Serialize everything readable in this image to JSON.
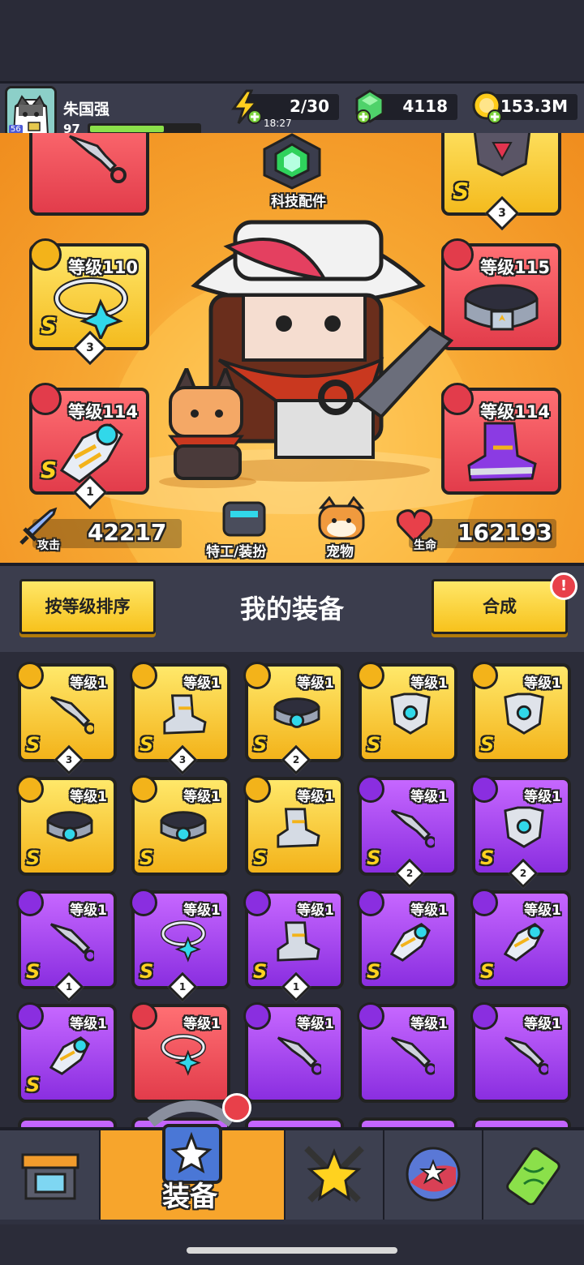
{
  "player": {
    "name": "朱国强",
    "level": "97",
    "avatar_badge": "56",
    "xp_fraction": 0.68
  },
  "resources": {
    "energy": "2/30",
    "energy_timer": "18:27",
    "gems": "4118",
    "coins": "153.3M"
  },
  "stage": {
    "tech_label": "科技配件",
    "slots": [
      {
        "id": "weapon",
        "level": "",
        "grade": "",
        "count": "",
        "color": "red"
      },
      {
        "id": "armor",
        "level": "",
        "grade": "S",
        "count": "3",
        "color": "gold"
      },
      {
        "id": "necklace",
        "level": "等级110",
        "grade": "S",
        "count": "3",
        "color": "gold"
      },
      {
        "id": "belt",
        "level": "等级115",
        "grade": "",
        "count": "",
        "color": "red"
      },
      {
        "id": "glove",
        "level": "等级114",
        "grade": "S",
        "count": "1",
        "color": "red"
      },
      {
        "id": "boots",
        "level": "等级114",
        "grade": "",
        "count": "",
        "color": "red"
      }
    ],
    "attack_label": "攻击",
    "attack_value": "42217",
    "agent_label": "特工/装扮",
    "pet_label": "宠物",
    "hp_label": "生命",
    "hp_value": "162193"
  },
  "equipment_header": {
    "sort_button": "按等级排序",
    "title": "我的装备",
    "merge_button": "合成"
  },
  "grid": [
    {
      "level": "等级1",
      "grade": "S",
      "count": "3",
      "color": "gold",
      "icon": "weapon"
    },
    {
      "level": "等级1",
      "grade": "S",
      "count": "3",
      "color": "gold",
      "icon": "boots"
    },
    {
      "level": "等级1",
      "grade": "S",
      "count": "2",
      "color": "gold",
      "icon": "belt"
    },
    {
      "level": "等级1",
      "grade": "S",
      "count": "",
      "color": "gold",
      "icon": "armor"
    },
    {
      "level": "等级1",
      "grade": "S",
      "count": "",
      "color": "gold",
      "icon": "armor"
    },
    {
      "level": "等级1",
      "grade": "S",
      "count": "",
      "color": "gold",
      "icon": "belt"
    },
    {
      "level": "等级1",
      "grade": "S",
      "count": "",
      "color": "gold",
      "icon": "belt"
    },
    {
      "level": "等级1",
      "grade": "S",
      "count": "",
      "color": "gold",
      "icon": "boots"
    },
    {
      "level": "等级1",
      "grade": "S",
      "count": "2",
      "color": "purple",
      "icon": "weapon"
    },
    {
      "level": "等级1",
      "grade": "S",
      "count": "2",
      "color": "purple",
      "icon": "armor"
    },
    {
      "level": "等级1",
      "grade": "S",
      "count": "1",
      "color": "purple",
      "icon": "weapon"
    },
    {
      "level": "等级1",
      "grade": "S",
      "count": "1",
      "color": "purple",
      "icon": "necklace"
    },
    {
      "level": "等级1",
      "grade": "S",
      "count": "1",
      "color": "purple",
      "icon": "boots"
    },
    {
      "level": "等级1",
      "grade": "S",
      "count": "",
      "color": "purple",
      "icon": "glove"
    },
    {
      "level": "等级1",
      "grade": "S",
      "count": "",
      "color": "purple",
      "icon": "glove"
    },
    {
      "level": "等级1",
      "grade": "S",
      "count": "",
      "color": "purple",
      "icon": "glove"
    },
    {
      "level": "等级1",
      "grade": "",
      "count": "",
      "color": "red",
      "icon": "necklace"
    },
    {
      "level": "等级1",
      "grade": "",
      "count": "",
      "color": "purple",
      "icon": "weapon"
    },
    {
      "level": "等级1",
      "grade": "",
      "count": "",
      "color": "purple",
      "icon": "weapon"
    },
    {
      "level": "等级1",
      "grade": "",
      "count": "",
      "color": "purple",
      "icon": "weapon"
    }
  ],
  "nav": {
    "active_label": "装备"
  },
  "colors": {
    "gold": "#f7c21c",
    "purple": "#9b3df0",
    "red": "#e6454f",
    "orange": "#f7a52c"
  }
}
